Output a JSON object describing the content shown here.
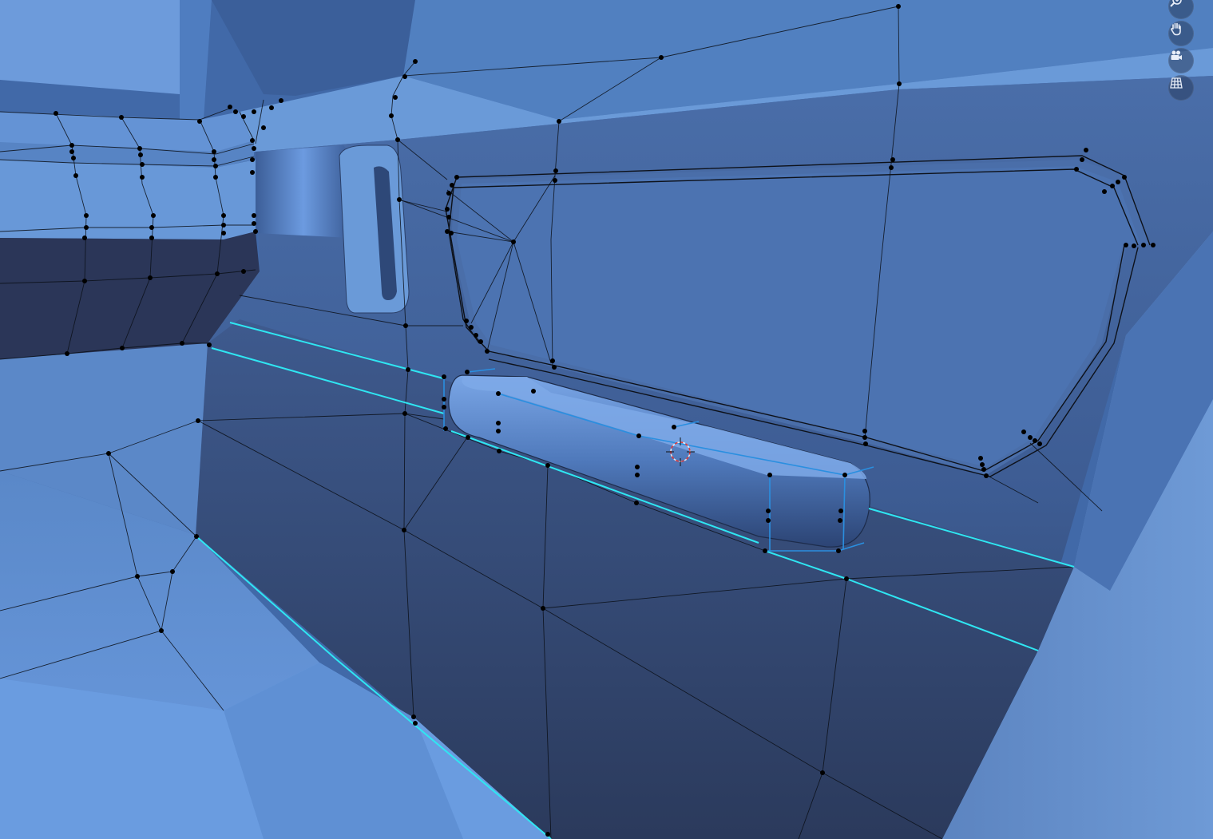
{
  "viewport": {
    "shading": "solid",
    "mode": "edit-mesh",
    "colors": {
      "mesh_base": "#3c5e93",
      "mesh_light": "#6b9ce0",
      "mesh_dark": "#28385a",
      "wire": "#0b0f18",
      "vertex": "#000000",
      "selected_edge": "#2fe6f2",
      "selected_edge_alt": "#2a8fe0",
      "cursor": "#e03a3a"
    }
  },
  "nav_gizmo": {
    "buttons": [
      {
        "name": "zoom",
        "icon": "magnifier-plus-icon"
      },
      {
        "name": "pan",
        "icon": "hand-icon"
      },
      {
        "name": "camera",
        "icon": "camera-icon"
      },
      {
        "name": "ortho-grid",
        "icon": "grid-icon"
      }
    ]
  }
}
